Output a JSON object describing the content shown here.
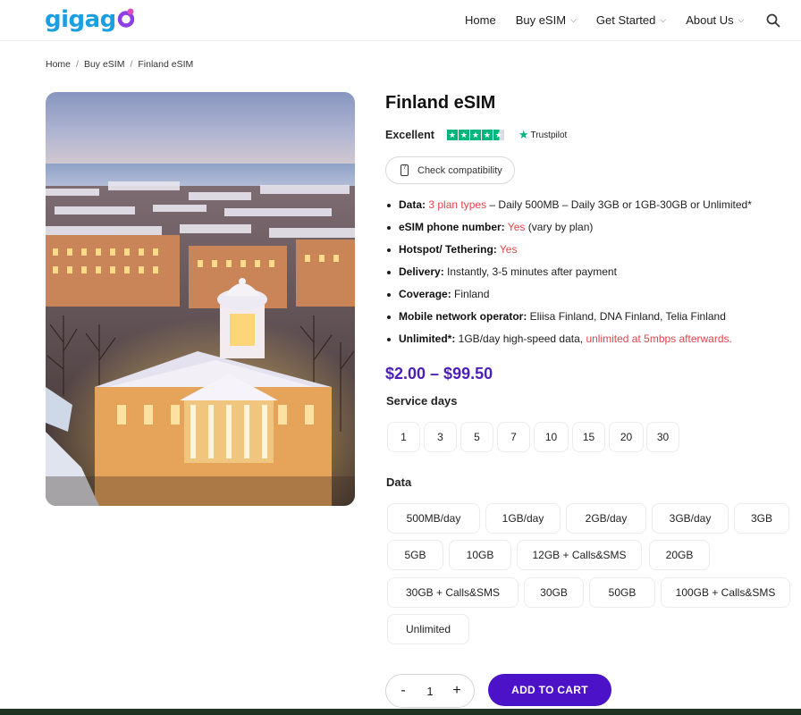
{
  "header": {
    "logo": "gigago",
    "nav": [
      {
        "label": "Home",
        "dropdown": false
      },
      {
        "label": "Buy eSIM",
        "dropdown": true
      },
      {
        "label": "Get Started",
        "dropdown": true
      },
      {
        "label": "About Us",
        "dropdown": true
      }
    ],
    "search_icon": "search-icon"
  },
  "breadcrumb": [
    "Home",
    "Buy eSIM",
    "Finland eSIM"
  ],
  "product": {
    "title": "Finland eSIM",
    "rating_text": "Excellent",
    "trustpilot": "Trustpilot",
    "rating_stars": 4.5,
    "check_label": "Check compatibility",
    "features": {
      "data": {
        "label": "Data:",
        "highlight": "3 plan types",
        "rest": " – Daily 500MB – Daily 3GB or 1GB-30GB or Unlimited*"
      },
      "number": {
        "label": "eSIM phone number:",
        "highlight": "Yes",
        "rest": " (vary by plan)"
      },
      "hotspot": {
        "label": "Hotspot/ Tethering:",
        "highlight": "Yes"
      },
      "delivery": {
        "label": "Delivery:",
        "rest": " Instantly, 3-5 minutes after payment"
      },
      "coverage": {
        "label": "Coverage:",
        "rest": " Finland"
      },
      "operator": {
        "label": "Mobile network operator:",
        "rest": " Eliisa Finland, DNA Finland, Telia Finland"
      },
      "unlimited": {
        "label": "Unlimited*:",
        "rest": " 1GB/day high-speed data, ",
        "highlight": "unlimited at 5mbps afterwards."
      }
    },
    "price": "$2.00 – $99.50",
    "service_days_label": "Service days",
    "service_days": [
      "1",
      "3",
      "5",
      "7",
      "10",
      "15",
      "20",
      "30"
    ],
    "data_label": "Data",
    "data_options": [
      "500MB/day",
      "1GB/day",
      "2GB/day",
      "3GB/day",
      "3GB",
      "5GB",
      "10GB",
      "12GB + Calls&SMS",
      "20GB",
      "30GB + Calls&SMS",
      "30GB",
      "50GB",
      "100GB + Calls&SMS",
      "Unlimited"
    ],
    "quantity": "1",
    "qty_minus": "-",
    "qty_plus": "+",
    "add_to_cart": "ADD TO CART"
  },
  "colors": {
    "brand_blue": "#1a9fe0",
    "brand_purple": "#4b12c7",
    "price_purple": "#4b1fb8",
    "highlight_red": "#e0464b",
    "trustpilot_green": "#00b67a"
  }
}
